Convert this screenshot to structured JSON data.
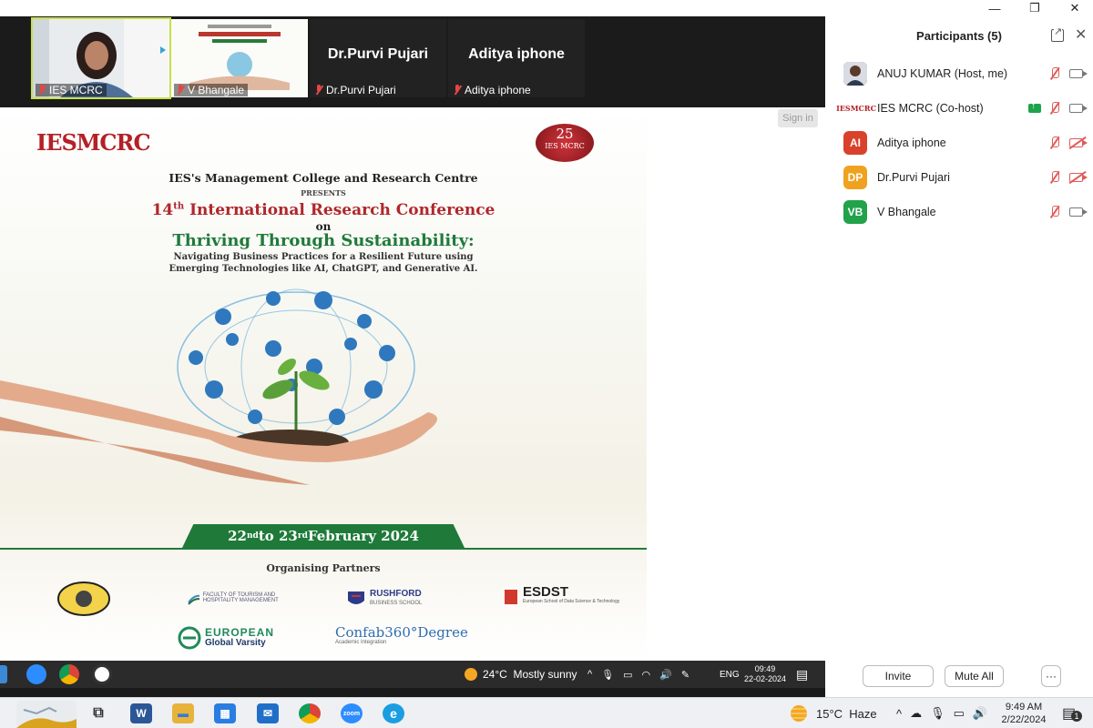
{
  "window": {
    "minimize_glyph": "—",
    "restore_glyph": "❐",
    "close_glyph": "✕"
  },
  "gallery": {
    "tiles": [
      {
        "name": "IES MCRC",
        "big_label": ""
      },
      {
        "name": "V Bhangale",
        "big_label": ""
      },
      {
        "name": "Dr.Purvi Pujari",
        "big_label": "Dr.Purvi Pujari"
      },
      {
        "name": "Aditya iphone",
        "big_label": "Aditya iphone"
      }
    ]
  },
  "share": {
    "signin_label": "Sign in",
    "poster": {
      "logo": "IESMCRC",
      "badge_number": "25",
      "badge_text": "IES MCRC",
      "college": "IES's Management College and Research Centre",
      "presents": "PRESENTS",
      "conference_prefix": "14",
      "conference_sup": "th",
      "conference_rest": " International Research Conference",
      "on": "on",
      "theme": "Thriving Through Sustainability:",
      "subtitle_1": "Navigating Business Practices for a Resilient Future using",
      "subtitle_2": "Emerging Technologies like AI, ChatGPT, and Generative AI.",
      "date_from": "22",
      "date_from_sup": "nd",
      "date_to": " to 23",
      "date_to_sup": "rd",
      "date_rest": " February 2024",
      "partners_heading": "Organising Partners",
      "partners": [
        {
          "name": "FACULTY OF TOURISM AND HOSPITALITY MANAGEMENT"
        },
        {
          "name": "RUSHFORD",
          "sub": "BUSINESS SCHOOL"
        },
        {
          "name": "ESDST",
          "sub": "European School of Data Science & Technology"
        },
        {
          "name": "EUROPEAN",
          "sub": "Global Varsity"
        },
        {
          "name": "Confab360°Degree",
          "sub": "Academic Integration"
        }
      ]
    },
    "inner_taskbar": {
      "weather_temp": "24°C",
      "weather_desc": "Mostly sunny",
      "lang": "ENG",
      "time": "09:49",
      "date": "22-02-2024"
    }
  },
  "panel": {
    "title": "Participants (5)",
    "participants": [
      {
        "initials": "",
        "name": "ANUJ KUMAR (Host, me)",
        "avatar_color": "#2d3b4f",
        "cam_off": false,
        "sharing": false
      },
      {
        "initials": "",
        "name": "IES MCRC (Co-host)",
        "avatar_color": "#ffffff",
        "cam_off": false,
        "sharing": true
      },
      {
        "initials": "AI",
        "name": "Aditya iphone",
        "avatar_color": "#d9412b",
        "cam_off": true,
        "sharing": false
      },
      {
        "initials": "DP",
        "name": "Dr.Purvi Pujari",
        "avatar_color": "#f0a21f",
        "cam_off": true,
        "sharing": false
      },
      {
        "initials": "VB",
        "name": "V Bhangale",
        "avatar_color": "#22a24a",
        "cam_off": false,
        "sharing": false
      }
    ],
    "invite_label": "Invite",
    "mute_all_label": "Mute All",
    "more_label": "···"
  },
  "taskbar": {
    "weather_temp": "15°C",
    "weather_desc": "Haze",
    "time": "9:49 AM",
    "date": "2/22/2024",
    "notification_count": "1",
    "apps": [
      {
        "name": "task-view",
        "glyph": "⧉"
      },
      {
        "name": "word",
        "glyph": "W",
        "color": "#2b5797"
      },
      {
        "name": "file-explorer",
        "glyph": "▬",
        "color": "#e8b33a"
      },
      {
        "name": "microsoft-store",
        "glyph": "▦",
        "color": "#2a7de1"
      },
      {
        "name": "mail",
        "glyph": "✉",
        "color": "#1f6fc9"
      },
      {
        "name": "chrome",
        "glyph": "",
        "color": "#dd4b39"
      },
      {
        "name": "zoom",
        "glyph": "zoom",
        "color": "#2d8cff"
      },
      {
        "name": "edge",
        "glyph": "e",
        "color": "#1b9de2"
      }
    ]
  }
}
